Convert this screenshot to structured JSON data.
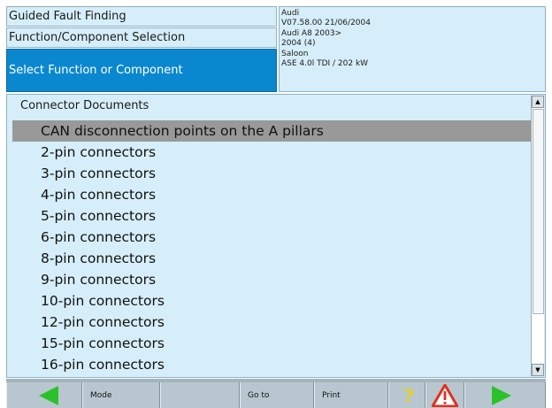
{
  "header": {
    "title": "Guided Fault Finding",
    "subtitle": "Function/Component Selection",
    "prompt": "Select Function or Component",
    "vehicle": {
      "make": "Audi",
      "version": "V07.58.00 21/06/2004",
      "model": "Audi A8 2003>",
      "year": "2004 (4)",
      "body": "Saloon",
      "engine": "ASE 4.0l TDI / 202 kW"
    }
  },
  "content": {
    "section_title": "Connector Documents",
    "items": [
      "CAN disconnection points on the A pillars",
      "2-pin connectors",
      "3-pin connectors",
      "4-pin connectors",
      "5-pin connectors",
      "6-pin connectors",
      "8-pin connectors",
      "9-pin connectors",
      "10-pin connectors",
      "12-pin connectors",
      "15-pin connectors",
      "16-pin connectors"
    ],
    "selected_index": 0
  },
  "toolbar": {
    "mode_label": "Mode",
    "goto_label": "Go to",
    "print_label": "Print",
    "help_symbol": "?"
  },
  "colors": {
    "panel_bg": "#d6eef9",
    "prompt_bg": "#0a88cf",
    "selected_bg": "#999999",
    "nav_arrow": "#2bc12b",
    "warning": "#e03020",
    "help": "#f1d200"
  },
  "icons": [
    "back-arrow-icon",
    "help-icon",
    "warning-icon",
    "forward-arrow-icon",
    "scroll-up-icon",
    "scroll-down-icon"
  ]
}
